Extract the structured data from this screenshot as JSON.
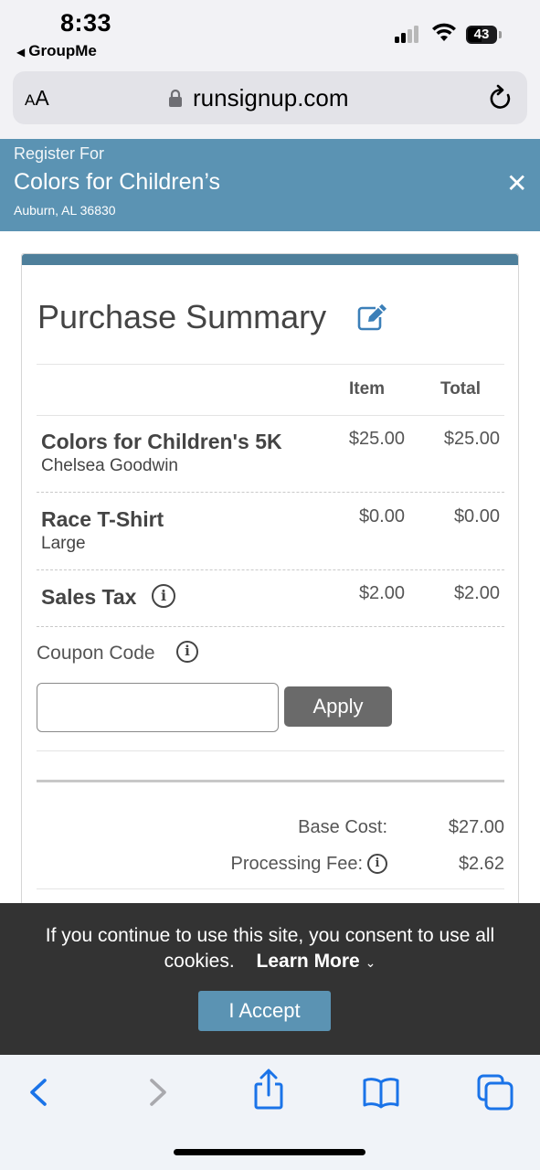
{
  "status": {
    "time": "8:33",
    "back_app": "GroupMe",
    "battery": "43"
  },
  "browser": {
    "aa": "AA",
    "url": "runsignup.com"
  },
  "header": {
    "label": "Register For",
    "title": "Colors for Children’s",
    "location": "Auburn, AL 36830"
  },
  "summary": {
    "title": "Purchase Summary",
    "col_item": "Item",
    "col_total": "Total",
    "rows": [
      {
        "name": "Colors for Children's 5K",
        "sub": "Chelsea Goodwin",
        "item": "$25.00",
        "total": "$25.00"
      },
      {
        "name": "Race T-Shirt",
        "sub": "Large",
        "item": "$0.00",
        "total": "$0.00"
      },
      {
        "name": "Sales Tax",
        "item": "$2.00",
        "total": "$2.00"
      }
    ],
    "coupon_label": "Coupon Code",
    "coupon_value": "",
    "apply_label": "Apply",
    "base_cost_label": "Base Cost:",
    "base_cost": "$27.00",
    "fee_label": "Processing Fee:",
    "fee": "$2.62"
  },
  "cookie": {
    "text": "If you continue to use this site, you consent to use all cookies.",
    "learn_more": "Learn More",
    "accept": "I Accept"
  },
  "colors": {
    "header_blue": "#5b93b3",
    "card_accent": "#4e7f9b",
    "ios_blue": "#1a73e8"
  },
  "toolbar_icons": [
    "back-icon",
    "forward-icon",
    "share-icon",
    "bookmarks-icon",
    "tabs-icon"
  ]
}
